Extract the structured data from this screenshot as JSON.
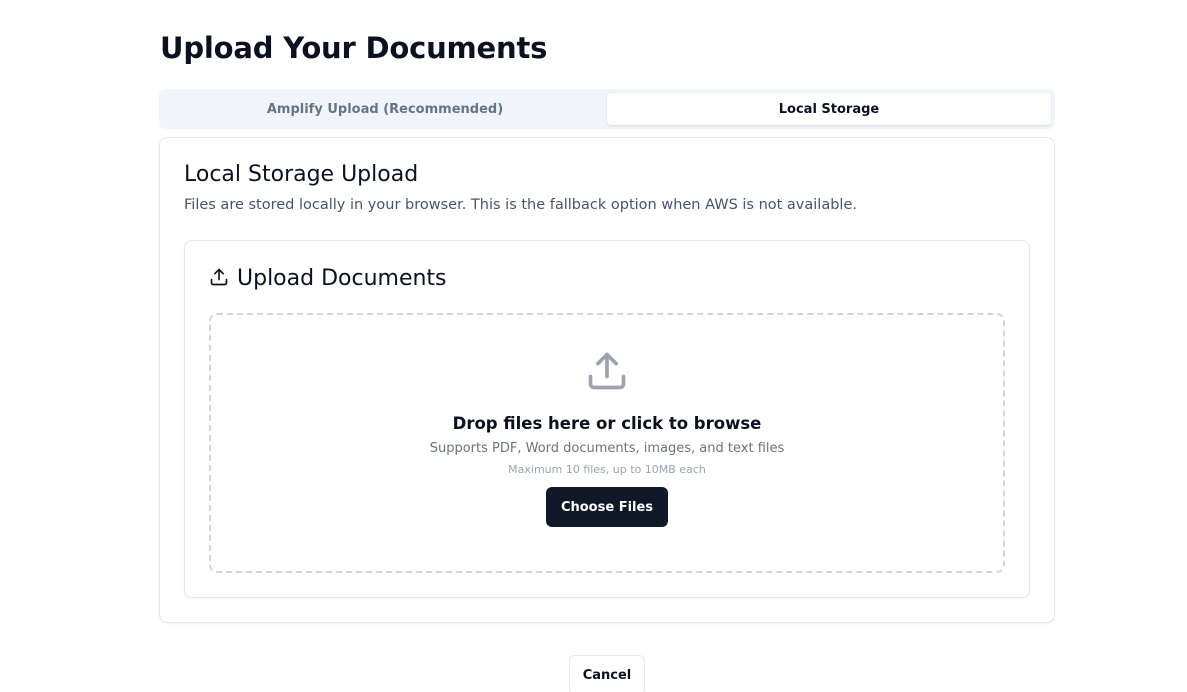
{
  "page": {
    "title": "Upload Your Documents"
  },
  "tabs": [
    {
      "label": "Amplify Upload (Recommended)",
      "active": false
    },
    {
      "label": "Local Storage",
      "active": true
    }
  ],
  "local_storage": {
    "title": "Local Storage Upload",
    "description": "Files are stored locally in your browser. This is the fallback option when AWS is not available."
  },
  "upload_card": {
    "title": "Upload Documents",
    "icon": "upload-icon"
  },
  "dropzone": {
    "icon": "upload-icon",
    "title": "Drop files here or click to browse",
    "supported": "Supports PDF, Word documents, images, and text files",
    "limit": "Maximum 10 files, up to 10MB each",
    "button_label": "Choose Files"
  },
  "actions": {
    "cancel_label": "Cancel"
  },
  "colors": {
    "primary_button": "#111827",
    "tab_bg": "#f1f5f9",
    "border": "#e2e8f0",
    "dashed_border": "#d1d5db",
    "icon_gray": "#9ca3af"
  }
}
